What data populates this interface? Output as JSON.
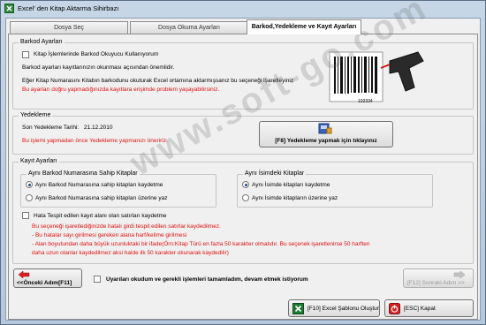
{
  "window": {
    "title": "Excel' den Kitap Aktarma Sihirbazı"
  },
  "tabs": [
    {
      "label": "Dosya Seç"
    },
    {
      "label": "Dosya Okuma Ayarları"
    },
    {
      "label": "Barkod,Yedekleme ve Kayıt Ayarları"
    }
  ],
  "barkod": {
    "title": "Barkod Ayarları",
    "checkbox_label": "Kitap İşlemlerinde Barkod Okuyucu Kullanıyorum",
    "line1": "Barkod ayarları kayıtlarınızın okunması açısından önemlidir.",
    "line2": "Eğer Kitap Numarasını Kitabın barkodunu okuturak Excel ortamına aktarmışsanız bu seçeneği işaretleyiniz",
    "warning": "Bu ayarları doğru yapmadığınızda kayıtlara erişimde problem yaşayabilirsiniz.",
    "barcode_number": "102334"
  },
  "yedekleme": {
    "title": "Yedekleme",
    "last_label": "Son Yedekleme Tarihi:",
    "last_date": "21.12.2010",
    "warning": "Bu işlemi yapmadan önce Yedekleme yapmanızı öneririz.",
    "button_label": "[F8] Yedekleme yapmak için tıklayınız"
  },
  "kayit": {
    "title": "Kayıt Ayarları",
    "group1": {
      "title": "Aynı Barkod Numarasına Sahip Kitaplar",
      "opt1": "Aynı Barkod Numarasına sahip kitapları kaydetme",
      "opt2": "Aynı Barkod Numarasına sahip kitapları üzerine yaz"
    },
    "group2": {
      "title": "Aynı İsimdeki Kitaplar",
      "opt1": "Aynı İsimde kitapları kaydetme",
      "opt2": "Aynı İsimde kitapların üzerine yaz"
    },
    "hata_label": "Hata Tespit edilen kayıt alanı olan satırları kaydetme",
    "notes": [
      "Bu seçeneği işaretlediğinizde hatalı girdi tespit edilen satırlar kaydedilmez.",
      "- Bu hatalar sayı girilmesi gereken alana harf/kelime girilmesi",
      "- Alan boyutundan daha büyük uzunluktaki bir ifade(Örn:Kitap Türü en fazla 50 karakter olmalıdır. Bu seçenek işaretlenirse 50 harften",
      "daha uzun olanlar kaydedilmez aksi halde ilk 50 karakter okunarak kaydedilir)"
    ]
  },
  "nav": {
    "prev_label": "<<Önceki Adım[F11]",
    "next_label": "[F12] Sonraki Adım >>",
    "confirm_label": "Uyarıları okudum ve gerekli işlemleri tamamladım, devam etmek istiyorum"
  },
  "footer": {
    "template_label": "[F10] Excel Şablonu Oluştur",
    "close_label": "[ESC] Kapat"
  },
  "watermark": "www.soft-go.com"
}
